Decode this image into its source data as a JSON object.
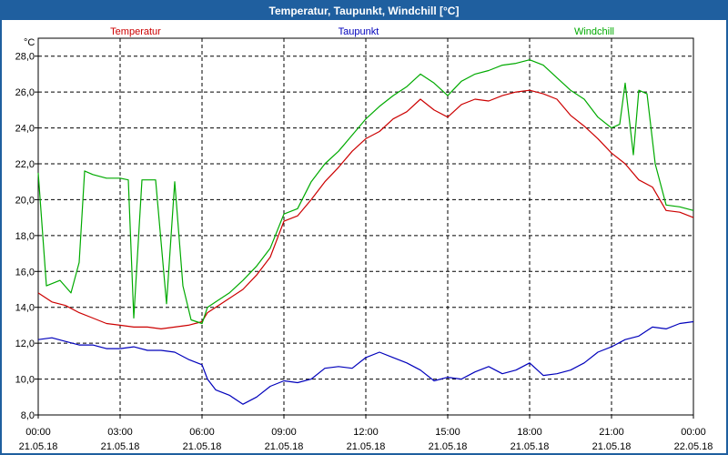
{
  "window": {
    "title": "Temperatur, Taupunkt, Windchill [°C]"
  },
  "chart_data": {
    "type": "line",
    "title": "Temperatur, Taupunkt, Windchill [°C]",
    "ylabel": "°C",
    "xlabel": "",
    "ylim": [
      8.0,
      29.0
    ],
    "xlim": [
      0,
      24
    ],
    "y_ticks": [
      "8,0",
      "10,0",
      "12,0",
      "14,0",
      "16,0",
      "18,0",
      "20,0",
      "22,0",
      "24,0",
      "26,0",
      "28,0"
    ],
    "x_ticks": [
      {
        "x": 0,
        "time": "00:00",
        "date": "21.05.18"
      },
      {
        "x": 3,
        "time": "03:00",
        "date": "21.05.18"
      },
      {
        "x": 6,
        "time": "06:00",
        "date": "21.05.18"
      },
      {
        "x": 9,
        "time": "09:00",
        "date": "21.05.18"
      },
      {
        "x": 12,
        "time": "12:00",
        "date": "21.05.18"
      },
      {
        "x": 15,
        "time": "15:00",
        "date": "21.05.18"
      },
      {
        "x": 18,
        "time": "18:00",
        "date": "21.05.18"
      },
      {
        "x": 21,
        "time": "21:00",
        "date": "21.05.18"
      },
      {
        "x": 24,
        "time": "00:00",
        "date": "22.05.18"
      }
    ],
    "grid": true,
    "legend": "top",
    "series": [
      {
        "name": "Temperatur",
        "color": "#cc0000",
        "points": [
          [
            0,
            14.8
          ],
          [
            0.5,
            14.3
          ],
          [
            1,
            14.1
          ],
          [
            1.5,
            13.7
          ],
          [
            2,
            13.4
          ],
          [
            2.5,
            13.1
          ],
          [
            3,
            13.0
          ],
          [
            3.5,
            12.9
          ],
          [
            4,
            12.9
          ],
          [
            4.5,
            12.8
          ],
          [
            5,
            12.9
          ],
          [
            5.5,
            13.0
          ],
          [
            6,
            13.2
          ],
          [
            6.2,
            13.7
          ],
          [
            6.5,
            14.0
          ],
          [
            7,
            14.5
          ],
          [
            7.5,
            15.0
          ],
          [
            8,
            15.8
          ],
          [
            8.5,
            16.8
          ],
          [
            9,
            18.8
          ],
          [
            9.5,
            19.1
          ],
          [
            10,
            20.0
          ],
          [
            10.5,
            21.0
          ],
          [
            11,
            21.8
          ],
          [
            11.5,
            22.7
          ],
          [
            12,
            23.4
          ],
          [
            12.5,
            23.8
          ],
          [
            13,
            24.5
          ],
          [
            13.5,
            24.9
          ],
          [
            14,
            25.6
          ],
          [
            14.5,
            25.0
          ],
          [
            15,
            24.6
          ],
          [
            15.5,
            25.3
          ],
          [
            16,
            25.6
          ],
          [
            16.5,
            25.5
          ],
          [
            17,
            25.8
          ],
          [
            17.5,
            26.0
          ],
          [
            18,
            26.1
          ],
          [
            18.5,
            25.9
          ],
          [
            19,
            25.6
          ],
          [
            19.5,
            24.7
          ],
          [
            20,
            24.1
          ],
          [
            20.5,
            23.4
          ],
          [
            21,
            22.6
          ],
          [
            21.5,
            22.0
          ],
          [
            22,
            21.1
          ],
          [
            22.5,
            20.7
          ],
          [
            23,
            19.4
          ],
          [
            23.5,
            19.3
          ],
          [
            24,
            19.0
          ]
        ]
      },
      {
        "name": "Taupunkt",
        "color": "#0000bb",
        "points": [
          [
            0,
            12.2
          ],
          [
            0.5,
            12.3
          ],
          [
            1,
            12.1
          ],
          [
            1.5,
            11.9
          ],
          [
            2,
            11.9
          ],
          [
            2.5,
            11.7
          ],
          [
            3,
            11.7
          ],
          [
            3.5,
            11.8
          ],
          [
            4,
            11.6
          ],
          [
            4.5,
            11.6
          ],
          [
            5,
            11.5
          ],
          [
            5.5,
            11.1
          ],
          [
            6,
            10.8
          ],
          [
            6.2,
            10.0
          ],
          [
            6.5,
            9.4
          ],
          [
            7,
            9.1
          ],
          [
            7.5,
            8.6
          ],
          [
            8,
            9.0
          ],
          [
            8.5,
            9.6
          ],
          [
            9,
            9.9
          ],
          [
            9.5,
            9.8
          ],
          [
            10,
            10.0
          ],
          [
            10.5,
            10.6
          ],
          [
            11,
            10.7
          ],
          [
            11.5,
            10.6
          ],
          [
            12,
            11.2
          ],
          [
            12.5,
            11.5
          ],
          [
            13,
            11.2
          ],
          [
            13.5,
            10.9
          ],
          [
            14,
            10.5
          ],
          [
            14.5,
            9.9
          ],
          [
            15,
            10.1
          ],
          [
            15.5,
            10.0
          ],
          [
            16,
            10.4
          ],
          [
            16.5,
            10.7
          ],
          [
            17,
            10.3
          ],
          [
            17.5,
            10.5
          ],
          [
            18,
            10.9
          ],
          [
            18.5,
            10.2
          ],
          [
            19,
            10.3
          ],
          [
            19.5,
            10.5
          ],
          [
            20,
            10.9
          ],
          [
            20.5,
            11.5
          ],
          [
            21,
            11.8
          ],
          [
            21.5,
            12.2
          ],
          [
            22,
            12.4
          ],
          [
            22.5,
            12.9
          ],
          [
            23,
            12.8
          ],
          [
            23.5,
            13.1
          ],
          [
            24,
            13.2
          ]
        ]
      },
      {
        "name": "Windchill",
        "color": "#00aa00",
        "points": [
          [
            0,
            21.5
          ],
          [
            0.3,
            15.2
          ],
          [
            0.8,
            15.5
          ],
          [
            1.2,
            14.8
          ],
          [
            1.5,
            16.5
          ],
          [
            1.7,
            21.6
          ],
          [
            2,
            21.4
          ],
          [
            2.5,
            21.2
          ],
          [
            3,
            21.2
          ],
          [
            3.3,
            21.1
          ],
          [
            3.5,
            13.4
          ],
          [
            3.8,
            21.1
          ],
          [
            4.3,
            21.1
          ],
          [
            4.7,
            14.2
          ],
          [
            5,
            21.0
          ],
          [
            5.3,
            15.2
          ],
          [
            5.6,
            13.3
          ],
          [
            6,
            13.1
          ],
          [
            6.2,
            14.0
          ],
          [
            6.5,
            14.3
          ],
          [
            7,
            14.8
          ],
          [
            7.5,
            15.5
          ],
          [
            8,
            16.3
          ],
          [
            8.5,
            17.3
          ],
          [
            9,
            19.2
          ],
          [
            9.5,
            19.5
          ],
          [
            10,
            21.0
          ],
          [
            10.5,
            22.0
          ],
          [
            11,
            22.7
          ],
          [
            11.5,
            23.6
          ],
          [
            12,
            24.5
          ],
          [
            12.5,
            25.2
          ],
          [
            13,
            25.8
          ],
          [
            13.5,
            26.3
          ],
          [
            14,
            27.0
          ],
          [
            14.5,
            26.5
          ],
          [
            15,
            25.8
          ],
          [
            15.5,
            26.6
          ],
          [
            16,
            27.0
          ],
          [
            16.5,
            27.2
          ],
          [
            17,
            27.5
          ],
          [
            17.5,
            27.6
          ],
          [
            18,
            27.8
          ],
          [
            18.5,
            27.5
          ],
          [
            19,
            26.8
          ],
          [
            19.5,
            26.1
          ],
          [
            20,
            25.6
          ],
          [
            20.5,
            24.6
          ],
          [
            21,
            24.0
          ],
          [
            21.3,
            24.2
          ],
          [
            21.5,
            26.5
          ],
          [
            21.8,
            22.5
          ],
          [
            22,
            26.1
          ],
          [
            22.3,
            25.9
          ],
          [
            22.6,
            22.0
          ],
          [
            23,
            19.7
          ],
          [
            23.5,
            19.6
          ],
          [
            24,
            19.4
          ]
        ]
      }
    ]
  }
}
